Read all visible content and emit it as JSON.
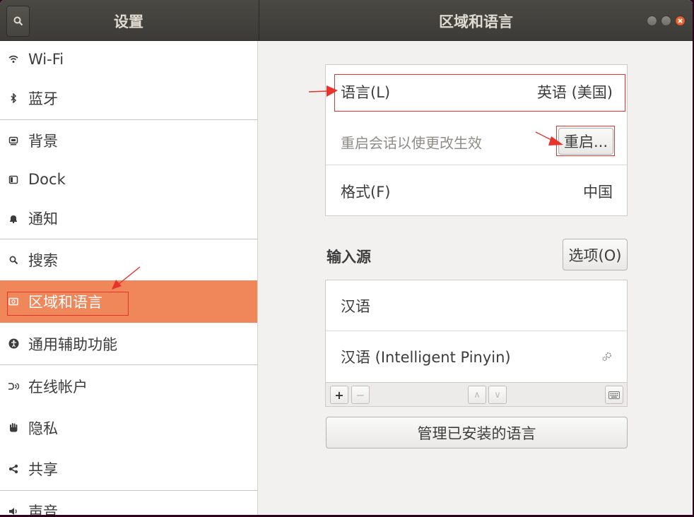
{
  "header": {
    "sidebar_title": "设置",
    "main_title": "区域和语言"
  },
  "sidebar": {
    "items": [
      {
        "label": "Wi-Fi",
        "icon": "wifi-icon"
      },
      {
        "label": "蓝牙",
        "icon": "bluetooth-icon"
      },
      {
        "label": "背景",
        "icon": "background-icon"
      },
      {
        "label": "Dock",
        "icon": "dock-icon"
      },
      {
        "label": "通知",
        "icon": "bell-icon"
      },
      {
        "label": "搜索",
        "icon": "search-icon"
      },
      {
        "label": "区域和语言",
        "icon": "flag-icon",
        "selected": true
      },
      {
        "label": "通用辅助功能",
        "icon": "accessibility-icon"
      },
      {
        "label": "在线帐户",
        "icon": "online-accounts-icon"
      },
      {
        "label": "隐私",
        "icon": "hand-icon"
      },
      {
        "label": "共享",
        "icon": "share-icon"
      },
      {
        "label": "声音",
        "icon": "speaker-icon"
      }
    ]
  },
  "language_panel": {
    "language_label": "语言(L)",
    "language_value": "英语 (美国)",
    "restart_hint": "重启会话以使更改生效",
    "restart_button": "重启...",
    "formats_label": "格式(F)",
    "formats_value": "中国"
  },
  "input_sources": {
    "heading": "输入源",
    "options_button": "选项(O)",
    "items": [
      {
        "label": "汉语"
      },
      {
        "label": "汉语 (Intelligent Pinyin)",
        "icon": "gear-icon"
      }
    ],
    "toolbar": {
      "add": "+",
      "remove": "−",
      "up": "∧",
      "down": "∨"
    }
  },
  "manage_button": "管理已安装的语言",
  "colors": {
    "accent": "#f0875a",
    "header_bg": "#3c3b37",
    "annotation": "#e8332c"
  }
}
